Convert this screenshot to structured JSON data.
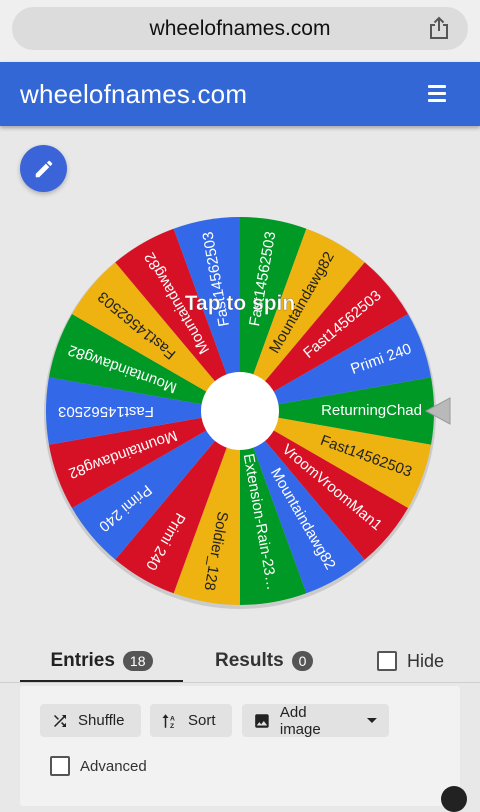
{
  "browser": {
    "url": "wheelofnames.com"
  },
  "app": {
    "brand": "wheelofnames.com"
  },
  "wheel": {
    "center_text": "Tap to spin",
    "colors": {
      "red": "#d61126",
      "blue": "#3369e8",
      "green": "#009925",
      "yellow": "#eeb211"
    },
    "slices": [
      {
        "label": "ReturningChad",
        "color": "green"
      },
      {
        "label": "Fast14562503",
        "color": "yellow"
      },
      {
        "label": "VroomVroomMan1",
        "color": "red"
      },
      {
        "label": "Mountaindawg82",
        "color": "blue"
      },
      {
        "label": "Extension-Rain-23…",
        "color": "green"
      },
      {
        "label": "Soldier_128",
        "color": "yellow"
      },
      {
        "label": "Primi 240",
        "color": "red"
      },
      {
        "label": "Primi 240",
        "color": "blue"
      },
      {
        "label": "Mountaindawg82",
        "color": "red"
      },
      {
        "label": "Fast14562503",
        "color": "blue"
      },
      {
        "label": "Mountaindawg82",
        "color": "green"
      },
      {
        "label": "Fast14562503",
        "color": "yellow"
      },
      {
        "label": "Mountaindawg82",
        "color": "red"
      },
      {
        "label": "Fast14562503",
        "color": "blue"
      },
      {
        "label": "Fast14562503",
        "color": "green"
      },
      {
        "label": "Mountaindawg82",
        "color": "yellow"
      },
      {
        "label": "Fast14562503",
        "color": "red"
      },
      {
        "label": "Primi 240",
        "color": "blue"
      }
    ]
  },
  "tabs": {
    "entries_label": "Entries",
    "entries_count": "18",
    "results_label": "Results",
    "results_count": "0",
    "hide_label": "Hide"
  },
  "toolbar": {
    "shuffle_label": "Shuffle",
    "sort_label": "Sort",
    "add_image_label": "Add image",
    "advanced_label": "Advanced"
  }
}
